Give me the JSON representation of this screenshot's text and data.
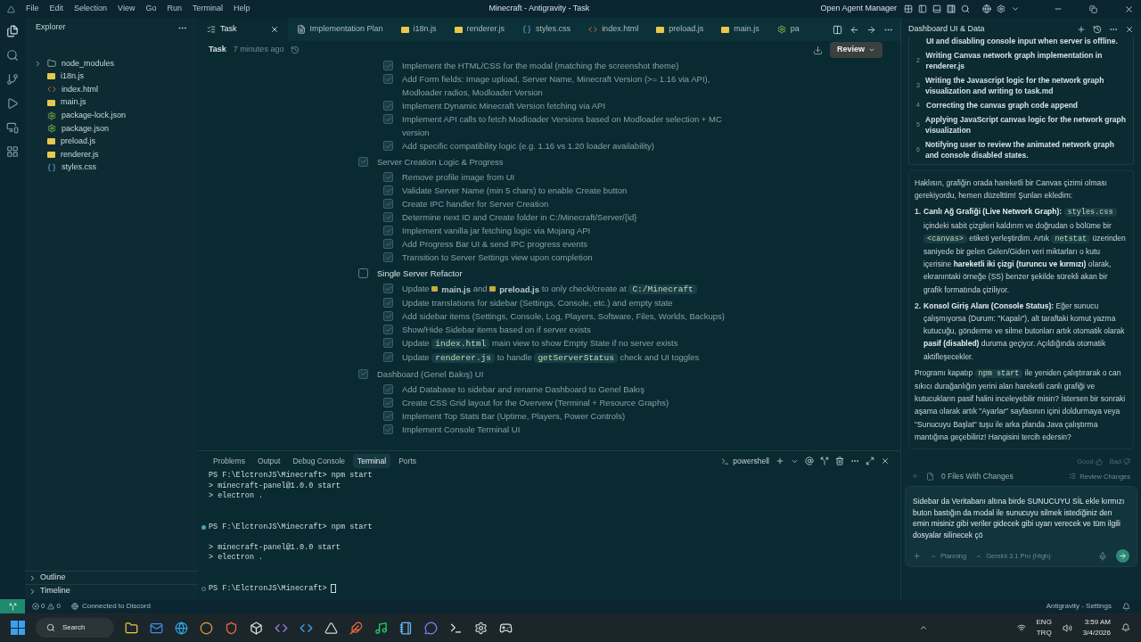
{
  "titlebar": {
    "menu": [
      "File",
      "Edit",
      "Selection",
      "View",
      "Go",
      "Run",
      "Terminal",
      "Help"
    ],
    "title": "Minecraft - Antigravity - Task",
    "agent_manager": "Open Agent Manager"
  },
  "explorer": {
    "title": "Explorer",
    "items": [
      {
        "name": "node_modules",
        "kind": "folder"
      },
      {
        "name": "i18n.js",
        "kind": "js"
      },
      {
        "name": "index.html",
        "kind": "html"
      },
      {
        "name": "main.js",
        "kind": "js"
      },
      {
        "name": "package-lock.json",
        "kind": "json"
      },
      {
        "name": "package.json",
        "kind": "json"
      },
      {
        "name": "preload.js",
        "kind": "js"
      },
      {
        "name": "renderer.js",
        "kind": "js"
      },
      {
        "name": "styles.css",
        "kind": "css"
      }
    ],
    "sections": [
      "Outline",
      "Timeline"
    ]
  },
  "editor_tabs": [
    {
      "label": "Task",
      "kind": "task",
      "selected": true
    },
    {
      "label": "Implementation Plan",
      "kind": "doc",
      "selected": false
    },
    {
      "label": "i18n.js",
      "kind": "js",
      "selected": false
    },
    {
      "label": "renderer.js",
      "kind": "js",
      "selected": false
    },
    {
      "label": "styles.css",
      "kind": "css",
      "selected": false
    },
    {
      "label": "index.html",
      "kind": "html",
      "selected": false
    },
    {
      "label": "preload.js",
      "kind": "js",
      "selected": false
    },
    {
      "label": "main.js",
      "kind": "js",
      "selected": false
    },
    {
      "label": "pa",
      "kind": "json",
      "selected": false
    }
  ],
  "task": {
    "title": "Task",
    "time": "7 minutes ago",
    "review": "Review",
    "groups": [
      {
        "items": [
          {
            "checked": true,
            "parts": [
              {
                "kind": "text",
                "text": "Implement the HTML/CSS for the modal (matching the screenshot theme)"
              }
            ]
          },
          {
            "checked": true,
            "parts": [
              {
                "kind": "text",
                "text": "Add Form fields: Image upload, Server Name, Minecraft Version (>= 1.16 via API), Modloader radios, Modloader Version"
              }
            ]
          },
          {
            "checked": true,
            "parts": [
              {
                "kind": "text",
                "text": "Implement Dynamic Minecraft Version fetching via API"
              }
            ]
          },
          {
            "checked": true,
            "parts": [
              {
                "kind": "text",
                "text": "Implement API calls to fetch Modloader Versions based on Modloader selection + MC version"
              }
            ]
          },
          {
            "checked": true,
            "parts": [
              {
                "kind": "text",
                "text": "Add specific compatibility logic (e.g. 1.16 vs 1.20 loader availability)"
              }
            ]
          }
        ]
      },
      {
        "title": "Server Creation Logic & Progress",
        "checked": true,
        "items": [
          {
            "checked": true,
            "parts": [
              {
                "kind": "text",
                "text": "Remove profile image from UI"
              }
            ]
          },
          {
            "checked": true,
            "parts": [
              {
                "kind": "text",
                "text": "Validate Server Name (min 5 chars) to enable Create button"
              }
            ]
          },
          {
            "checked": true,
            "parts": [
              {
                "kind": "text",
                "text": "Create IPC handler for Server Creation"
              }
            ]
          },
          {
            "checked": true,
            "parts": [
              {
                "kind": "text",
                "text": "Determine next ID and Create folder in C:/Minecraft/Server/{id}"
              }
            ]
          },
          {
            "checked": true,
            "parts": [
              {
                "kind": "text",
                "text": "Implement vanilla jar fetching logic via Mojang API"
              }
            ]
          },
          {
            "checked": true,
            "parts": [
              {
                "kind": "text",
                "text": "Add Progress Bar UI & send IPC progress events"
              }
            ]
          },
          {
            "checked": true,
            "parts": [
              {
                "kind": "text",
                "text": "Transition to Server Settings view upon completion"
              }
            ]
          }
        ]
      },
      {
        "title": "Single Server Refactor",
        "checked": false,
        "items": [
          {
            "checked": true,
            "parts": [
              {
                "kind": "text",
                "text": "Update "
              },
              {
                "kind": "file",
                "text": "main.js"
              },
              {
                "kind": "text",
                "text": " and "
              },
              {
                "kind": "file",
                "text": "preload.js"
              },
              {
                "kind": "text",
                "text": " to only check/create at "
              },
              {
                "kind": "code",
                "text": "C:/Minecraft"
              }
            ]
          },
          {
            "checked": true,
            "parts": [
              {
                "kind": "text",
                "text": "Update translations for sidebar (Settings, Console, etc.) and empty state"
              }
            ]
          },
          {
            "checked": true,
            "parts": [
              {
                "kind": "text",
                "text": "Add sidebar items (Settings, Console, Log, Players, Software, Files, Worlds, Backups)"
              }
            ]
          },
          {
            "checked": true,
            "parts": [
              {
                "kind": "text",
                "text": "Show/Hide Sidebar items based on if server exists"
              }
            ]
          },
          {
            "checked": true,
            "parts": [
              {
                "kind": "text",
                "text": "Update "
              },
              {
                "kind": "code",
                "text": "index.html"
              },
              {
                "kind": "text",
                "text": " main view to show Empty State if no server exists"
              }
            ]
          },
          {
            "checked": true,
            "parts": [
              {
                "kind": "text",
                "text": "Update "
              },
              {
                "kind": "code",
                "text": "renderer.js"
              },
              {
                "kind": "text",
                "text": " to handle "
              },
              {
                "kind": "code",
                "text": "getServerStatus"
              },
              {
                "kind": "text",
                "text": " check and UI toggles"
              }
            ]
          }
        ]
      },
      {
        "title": "Dashboard (Genel Bakış) UI",
        "checked": true,
        "items": [
          {
            "checked": true,
            "parts": [
              {
                "kind": "text",
                "text": "Add Database to sidebar and rename Dashboard to Genel Bakış"
              }
            ]
          },
          {
            "checked": true,
            "parts": [
              {
                "kind": "text",
                "text": "Create CSS Grid layout for the Overvew (Terminal + Resource Graphs)"
              }
            ]
          },
          {
            "checked": true,
            "parts": [
              {
                "kind": "text",
                "text": "Implement Top Stats Bar (Uptime, Players, Power Controls)"
              }
            ]
          },
          {
            "checked": true,
            "parts": [
              {
                "kind": "text",
                "text": "Implement Console Terminal UI"
              }
            ]
          }
        ]
      }
    ]
  },
  "panel": {
    "tabs": [
      {
        "label": "Problems",
        "selected": false
      },
      {
        "label": "Output",
        "selected": false
      },
      {
        "label": "Debug Console",
        "selected": false
      },
      {
        "label": "Terminal",
        "selected": true
      },
      {
        "label": "Ports",
        "selected": false
      }
    ],
    "shell": "powershell",
    "lines": [
      {
        "kind": "prompt",
        "prompt": "PS F:\\ElctronJS\\Minecraft>",
        "command": "npm start"
      },
      {
        "kind": "output",
        "text": "> minecraft-panel@1.0.0 start"
      },
      {
        "kind": "output",
        "text": "> electron ."
      },
      {
        "kind": "blank"
      },
      {
        "kind": "blank"
      },
      {
        "kind": "prompt",
        "dot": true,
        "dot_filled": true,
        "prompt": "PS F:\\ElctronJS\\Minecraft>",
        "command": "npm start"
      },
      {
        "kind": "blank"
      },
      {
        "kind": "output",
        "text": "> minecraft-panel@1.0.0 start"
      },
      {
        "kind": "output",
        "text": "> electron ."
      },
      {
        "kind": "blank"
      },
      {
        "kind": "blank"
      },
      {
        "kind": "prompt",
        "dot": true,
        "dot_filled": false,
        "prompt": "PS F:\\ElctronJS\\Minecraft>",
        "cursor": true
      }
    ]
  },
  "agent": {
    "title": "Dashboard UI & Data",
    "steps": [
      {
        "text": "UI and disabling console input when server is offline."
      },
      {
        "num": "2",
        "text": "Writing Canvas network graph implementation in renderer.js"
      },
      {
        "num": "3",
        "text": "Writing the Javascript logic for the network graph visualization and writing to task.md"
      },
      {
        "num": "4",
        "text": "Correcting the canvas graph code append"
      },
      {
        "num": "5",
        "text": "Applying JavaScript canvas logic for the network graph visualization"
      },
      {
        "num": "6",
        "text": "Notifying user to review the animated network graph and console disabled states."
      }
    ],
    "intro": "Haklısın, grafiğin orada hareketli bir Canvas çizimi olması gerekiyordu, hemen düzelttim! Şunları ekledim:",
    "list": [
      {
        "num": "1.",
        "parts": [
          {
            "kind": "bold",
            "text": "Canlı Ağ Grafiği (Live Network Graph): "
          },
          {
            "kind": "code",
            "text": "styles.css"
          },
          {
            "kind": "text",
            "text": " içindeki sabit çizgileri kaldırım ve doğrudan o bölüme bir "
          },
          {
            "kind": "code",
            "text": "<canvas>"
          },
          {
            "kind": "text",
            "text": " etiketi yerleştirdim. Artık "
          },
          {
            "kind": "code",
            "text": "netstat"
          },
          {
            "kind": "text",
            "text": " üzerinden saniyede bir gelen Gelen/Giden veri miktarları o kutu içerisine "
          },
          {
            "kind": "bold",
            "text": "hareketli iki çizgi (turuncu ve kırmızı)"
          },
          {
            "kind": "text",
            "text": " olarak, ekranıntaki örneğe (SS) benzer şekilde sürekli akan bir grafik formatında çiziliyor."
          }
        ]
      },
      {
        "num": "2.",
        "parts": [
          {
            "kind": "bold",
            "text": "Konsol Giriş Alanı (Console Status):"
          },
          {
            "kind": "text",
            "text": " Eğer sunucu çalışmıyorsa (Durum: \"Kapalı\"), alt taraftaki komut yazma kutucuğu, gönderme ve silme butonları artık otomatik olarak "
          },
          {
            "kind": "bold",
            "text": "pasif (disabled)"
          },
          {
            "kind": "text",
            "text": " duruma geçiyor. Açıldığında otomatik aktifleşecekler."
          }
        ]
      }
    ],
    "outro": [
      {
        "kind": "text",
        "text": "Programı kapatıp "
      },
      {
        "kind": "code",
        "text": "npm start"
      },
      {
        "kind": "text",
        "text": " ile yeniden çalıştırarak o can sıkıcı durağanlığın yerini alan hareketli canlı grafiği ve kutucukların pasif halini inceleyebilir misin? İstersen bir sonraki aşama olarak artık \"Ayarlar\" sayfasının içini doldurmaya veya \"Sunucuyu Başlat\" tuşu ile arka planda Java çalıştırma mantığına geçebiliriz! Hangisini tercih edersin?"
      }
    ],
    "good": "Good",
    "bad": "Bad",
    "files": "0 Files With Changes",
    "review_changes": "Review Changes",
    "input": "Sidebar da Veritabanı altına birde SUNUCUYU SİL ekle kırmızı buton bastığın da modal ile sunucuyu silmek istediğiniz den emin misiniz gibi veriler gidecek gibi uyarı verecek ve tüm ilgili dosyalar silinecek çö",
    "mode": "Planning",
    "model": "Gemini 3.1 Pro (High)"
  },
  "status_bar": {
    "errors": "0",
    "warnings": "0",
    "discord": "Connected to Discord",
    "settings": "Antigravity - Settings"
  },
  "taskbar": {
    "search": "Search",
    "lang": "ENG",
    "layout": "TRQ",
    "time": "3:59 AM",
    "date": "3/4/2026"
  }
}
